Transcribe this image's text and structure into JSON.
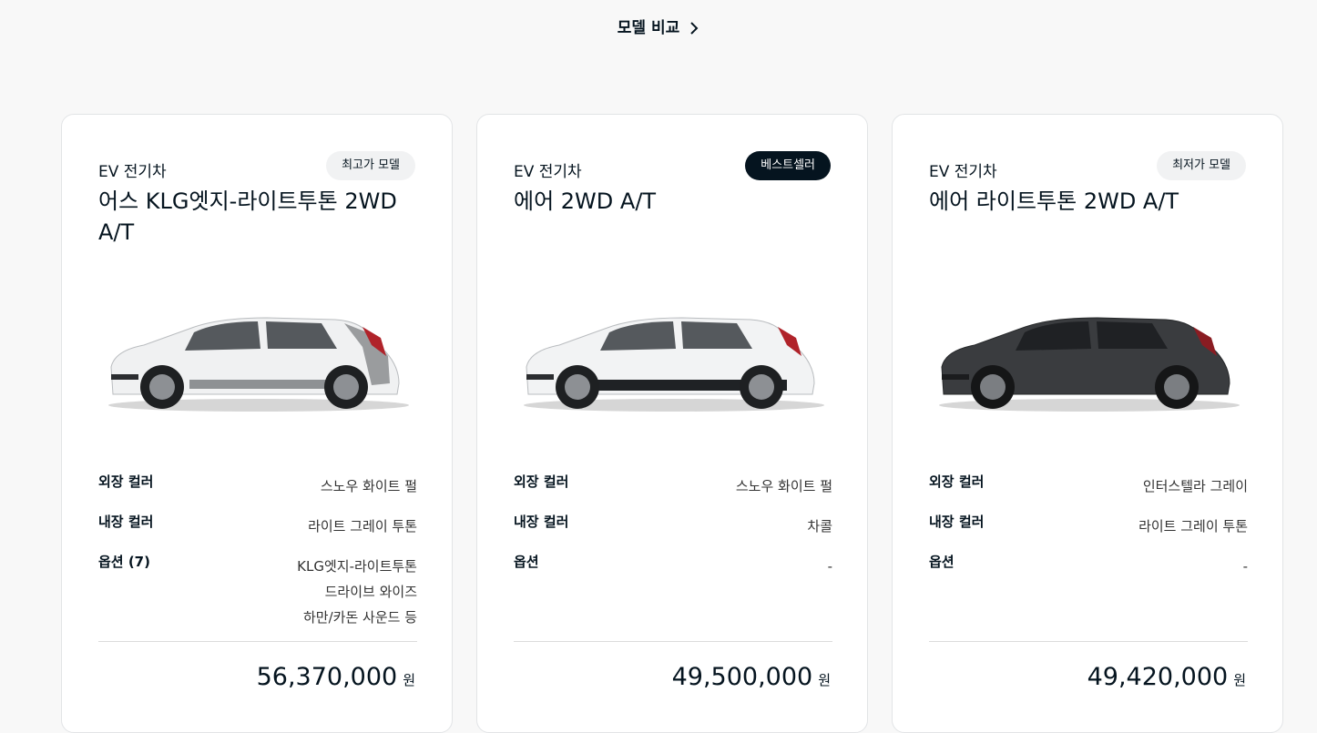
{
  "header": {
    "compare_label": "모델 비교"
  },
  "cards": [
    {
      "category": "EV 전기차",
      "badge": "최고가 모델",
      "name": "어스 KLG엣지-라이트투톤 2WD A/T",
      "car_color": "#f0f1f2",
      "specs": {
        "exterior_label": "외장 컬러",
        "exterior_value": "스노우 화이트 펄",
        "interior_label": "내장 컬러",
        "interior_value": "라이트 그레이 투톤",
        "option_label": "옵션 (7)",
        "option_values": [
          "KLG엣지-라이트투톤",
          "드라이브 와이즈",
          "하만/카돈 사운드 등"
        ]
      },
      "price": "56,370,000",
      "currency": "원"
    },
    {
      "category": "EV 전기차",
      "badge": "베스트셀러",
      "name": "에어 2WD A/T",
      "car_color": "#f2f3f4",
      "specs": {
        "exterior_label": "외장 컬러",
        "exterior_value": "스노우 화이트 펄",
        "interior_label": "내장 컬러",
        "interior_value": "차콜",
        "option_label": "옵션",
        "option_values": [
          "-"
        ]
      },
      "price": "49,500,000",
      "currency": "원"
    },
    {
      "category": "EV 전기차",
      "badge": "최저가 모델",
      "name": "에어 라이트투톤 2WD A/T",
      "car_color": "#3a3c3f",
      "specs": {
        "exterior_label": "외장 컬러",
        "exterior_value": "인터스텔라 그레이",
        "interior_label": "내장 컬러",
        "interior_value": "라이트 그레이 투톤",
        "option_label": "옵션",
        "option_values": [
          "-"
        ]
      },
      "price": "49,420,000",
      "currency": "원"
    }
  ]
}
